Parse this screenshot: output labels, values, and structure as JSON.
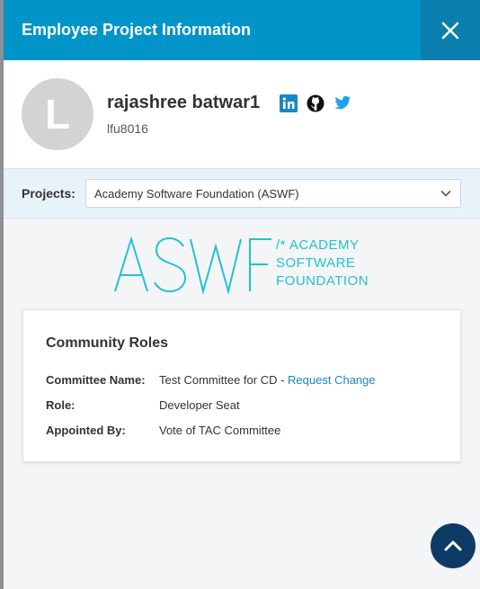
{
  "header": {
    "title": "Employee Project Information"
  },
  "profile": {
    "avatar_letter": "L",
    "name": "rajashree batwar1",
    "user_id": "lfu8016",
    "social": [
      "linkedin-icon",
      "github-icon",
      "twitter-icon"
    ]
  },
  "projects": {
    "label": "Projects:",
    "selected": "Academy Software Foundation (ASWF)"
  },
  "logo": {
    "big": "ASWF",
    "line1": "/* ACADEMY",
    "line2": "SOFTWARE",
    "line3": "FOUNDATION"
  },
  "card": {
    "title": "Community Roles",
    "rows": [
      {
        "key": "Committee Name:",
        "value": "Test Committee for CD",
        "link_prefix": " - ",
        "link": "Request Change"
      },
      {
        "key": "Role:",
        "value": "Developer Seat"
      },
      {
        "key": "Appointed By:",
        "value": "Vote of TAC Committee"
      }
    ]
  },
  "colors": {
    "header_bg": "#0094c9",
    "accent": "#1b86c6",
    "logo": "#24c0d3",
    "scroll_button": "#0d3b66"
  }
}
